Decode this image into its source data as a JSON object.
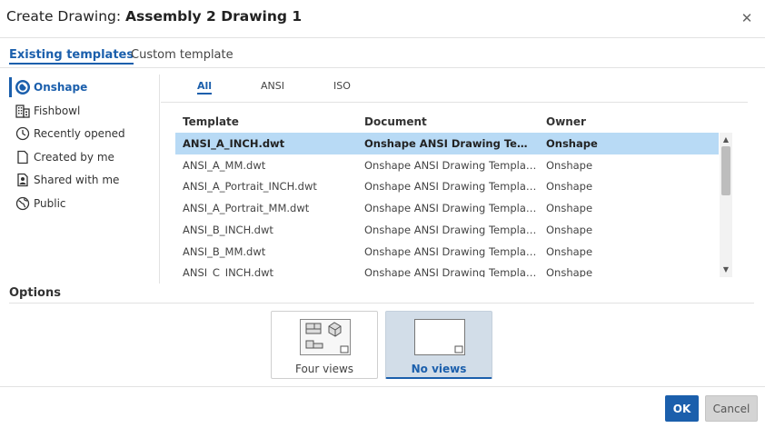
{
  "dialog": {
    "title_prefix": "Create Drawing: ",
    "title_name": "Assembly 2 Drawing 1"
  },
  "tabs": {
    "existing": "Existing templates",
    "custom": "Custom template"
  },
  "sidebar": {
    "items": [
      {
        "label": "Onshape",
        "icon": "onshape-logo-icon"
      },
      {
        "label": "Fishbowl",
        "icon": "building-icon"
      },
      {
        "label": "Recently opened",
        "icon": "clock-icon"
      },
      {
        "label": "Created by me",
        "icon": "document-icon"
      },
      {
        "label": "Shared with me",
        "icon": "shared-user-icon"
      },
      {
        "label": "Public",
        "icon": "globe-icon"
      }
    ]
  },
  "filters": {
    "all": "All",
    "ansi": "ANSI",
    "iso": "ISO"
  },
  "table": {
    "headers": {
      "template": "Template",
      "document": "Document",
      "owner": "Owner"
    },
    "rows": [
      {
        "template": "ANSI_A_INCH.dwt",
        "document": "Onshape ANSI Drawing Templat...",
        "owner": "Onshape"
      },
      {
        "template": "ANSI_A_MM.dwt",
        "document": "Onshape ANSI Drawing Templates",
        "owner": "Onshape"
      },
      {
        "template": "ANSI_A_Portrait_INCH.dwt",
        "document": "Onshape ANSI Drawing Templates",
        "owner": "Onshape"
      },
      {
        "template": "ANSI_A_Portrait_MM.dwt",
        "document": "Onshape ANSI Drawing Templates",
        "owner": "Onshape"
      },
      {
        "template": "ANSI_B_INCH.dwt",
        "document": "Onshape ANSI Drawing Templates",
        "owner": "Onshape"
      },
      {
        "template": "ANSI_B_MM.dwt",
        "document": "Onshape ANSI Drawing Templates",
        "owner": "Onshape"
      },
      {
        "template": "ANSI_C_INCH.dwt",
        "document": "Onshape ANSI Drawing Templates",
        "owner": "Onshape"
      }
    ]
  },
  "options": {
    "label": "Options",
    "four_views": "Four views",
    "no_views": "No views"
  },
  "buttons": {
    "ok": "OK",
    "cancel": "Cancel"
  },
  "colors": {
    "accent": "#1b5fac",
    "selected_row": "#b8daf5",
    "selected_card": "#d2dde8"
  }
}
